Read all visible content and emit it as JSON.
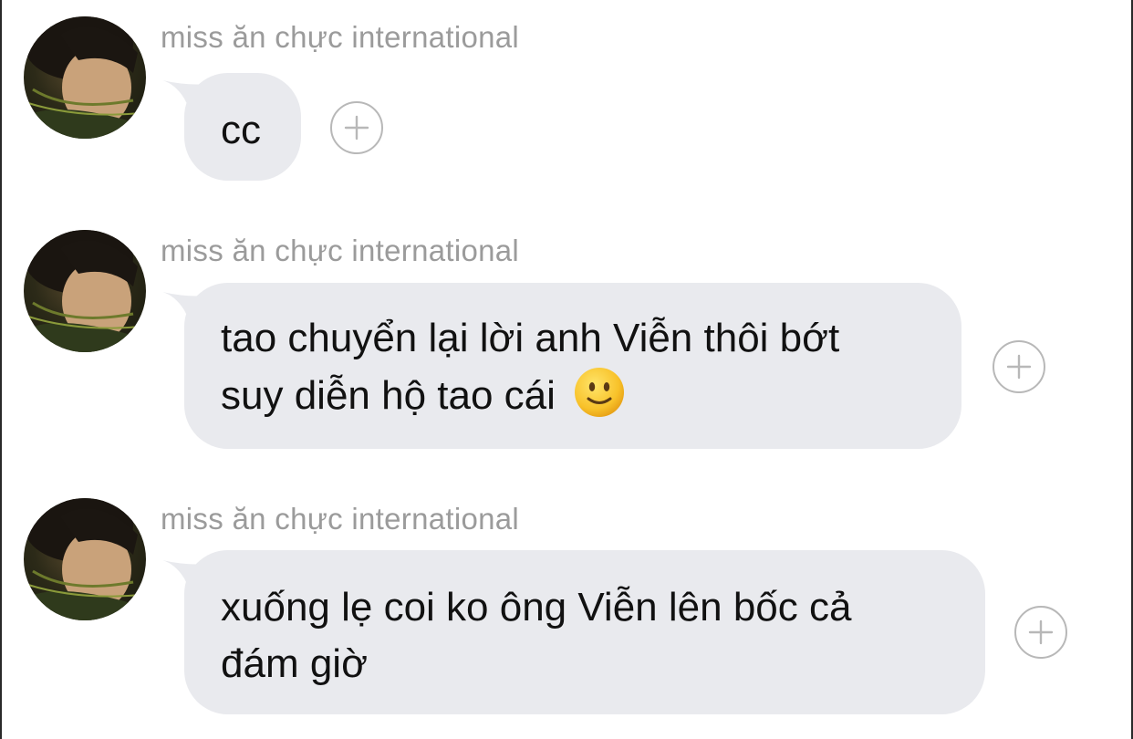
{
  "messages": [
    {
      "sender": "miss ăn chực international",
      "text": "cc",
      "add_icon": "plus-circle-icon"
    },
    {
      "sender": "miss ăn chực international",
      "line1": "tao chuyển lại lời anh Viễn thôi bớt",
      "line2": "suy diễn hộ tao cái",
      "emoji": "slightly-smiling-face-emoji",
      "add_icon": "plus-circle-icon"
    },
    {
      "sender": "miss ăn chực international",
      "line1": "xuống lẹ coi ko ông Viễn lên bốc cả",
      "line2": "đám giờ",
      "add_icon": "plus-circle-icon"
    }
  ],
  "colors": {
    "bubble": "#e9eaee",
    "sender_text": "#9b9b9b",
    "message_text": "#111111",
    "add_button_border": "#b8b8b8"
  }
}
